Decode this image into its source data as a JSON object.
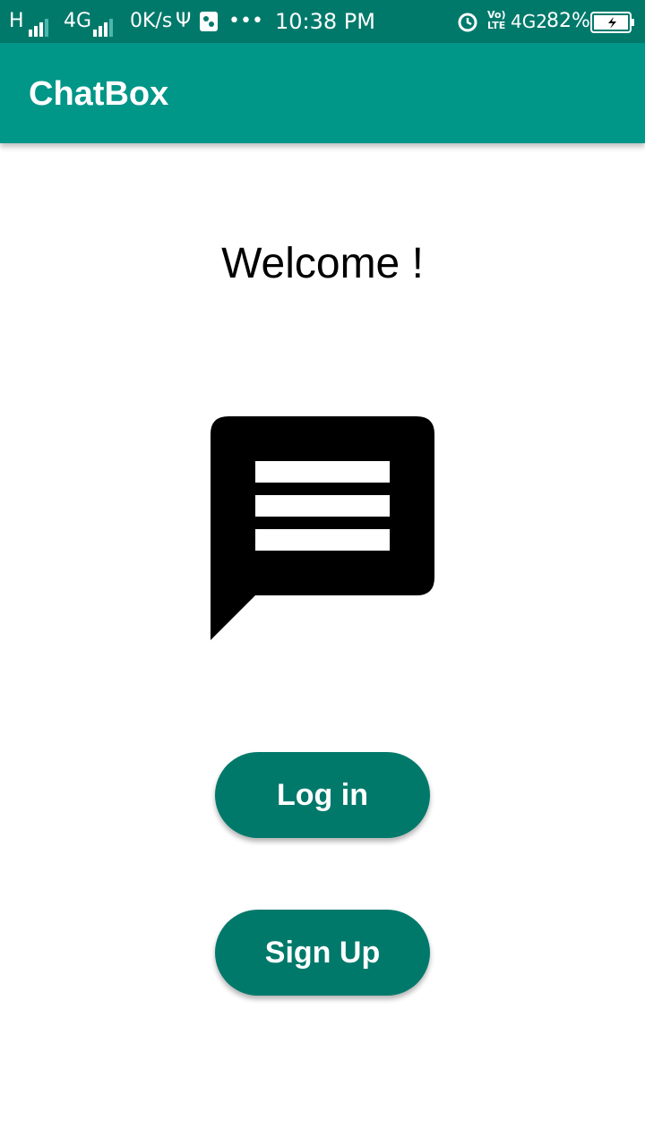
{
  "status_bar": {
    "carrier1": "H",
    "carrier2": "4G",
    "net_speed": "0K/s",
    "usb_glyph": "Ψ",
    "more": "•••",
    "time": "10:38 PM",
    "volte": "Vo)",
    "lte": "LTE",
    "network": "4G2",
    "battery": "82%",
    "icons": [
      "signal-icon",
      "usb-icon",
      "nfc-icon",
      "alarm-icon",
      "battery-icon"
    ]
  },
  "app_bar": {
    "title": "ChatBox"
  },
  "main": {
    "welcome_text": "Welcome !",
    "hero_icon": "chat-bubble-icon",
    "login_label": "Log in",
    "signup_label": "Sign Up"
  },
  "colors": {
    "status_bar": "#00796b",
    "app_bar": "#009688",
    "button": "#00796b"
  }
}
